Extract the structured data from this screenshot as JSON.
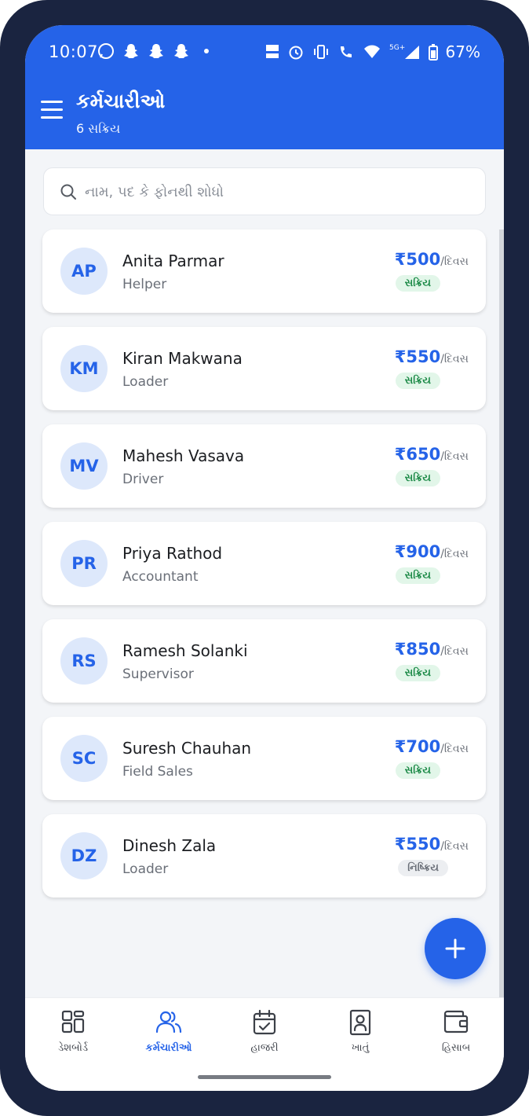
{
  "status_bar": {
    "time": "10:07",
    "battery": "67%",
    "network": "5G+"
  },
  "header": {
    "title": "કર્મચારીઓ",
    "subtitle": "6 સક્રિય"
  },
  "search": {
    "placeholder": "નામ, પદ કે ફોનથી શોધો"
  },
  "wage_unit": "/દિવસ",
  "employees": [
    {
      "initials": "AP",
      "name": "Anita Parmar",
      "role": "Helper",
      "wage": "₹500",
      "status": "સક્રિય",
      "status_type": "active"
    },
    {
      "initials": "KM",
      "name": "Kiran Makwana",
      "role": "Loader",
      "wage": "₹550",
      "status": "સક્રિય",
      "status_type": "active"
    },
    {
      "initials": "MV",
      "name": "Mahesh Vasava",
      "role": "Driver",
      "wage": "₹650",
      "status": "સક્રિય",
      "status_type": "active"
    },
    {
      "initials": "PR",
      "name": "Priya Rathod",
      "role": "Accountant",
      "wage": "₹900",
      "status": "સક્રિય",
      "status_type": "active"
    },
    {
      "initials": "RS",
      "name": "Ramesh Solanki",
      "role": "Supervisor",
      "wage": "₹850",
      "status": "સક્રિય",
      "status_type": "active"
    },
    {
      "initials": "SC",
      "name": "Suresh Chauhan",
      "role": "Field Sales",
      "wage": "₹700",
      "status": "સક્રિય",
      "status_type": "active"
    },
    {
      "initials": "DZ",
      "name": "Dinesh Zala",
      "role": "Loader",
      "wage": "₹550",
      "status": "નિષ્ક્રિય",
      "status_type": "inactive"
    }
  ],
  "nav": [
    {
      "label": "ડેશબોર્ડ",
      "icon": "dashboard-icon",
      "active": false
    },
    {
      "label": "કર્મચારીઓ",
      "icon": "users-icon",
      "active": true
    },
    {
      "label": "હાજરી",
      "icon": "calendar-check-icon",
      "active": false
    },
    {
      "label": "ખાતું",
      "icon": "contact-book-icon",
      "active": false
    },
    {
      "label": "હિસાબ",
      "icon": "wallet-icon",
      "active": false
    }
  ],
  "colors": {
    "primary": "#2563e8",
    "active_badge_bg": "#e2f6e9",
    "active_badge_text": "#1c8a47",
    "inactive_badge_bg": "#eceef1"
  }
}
